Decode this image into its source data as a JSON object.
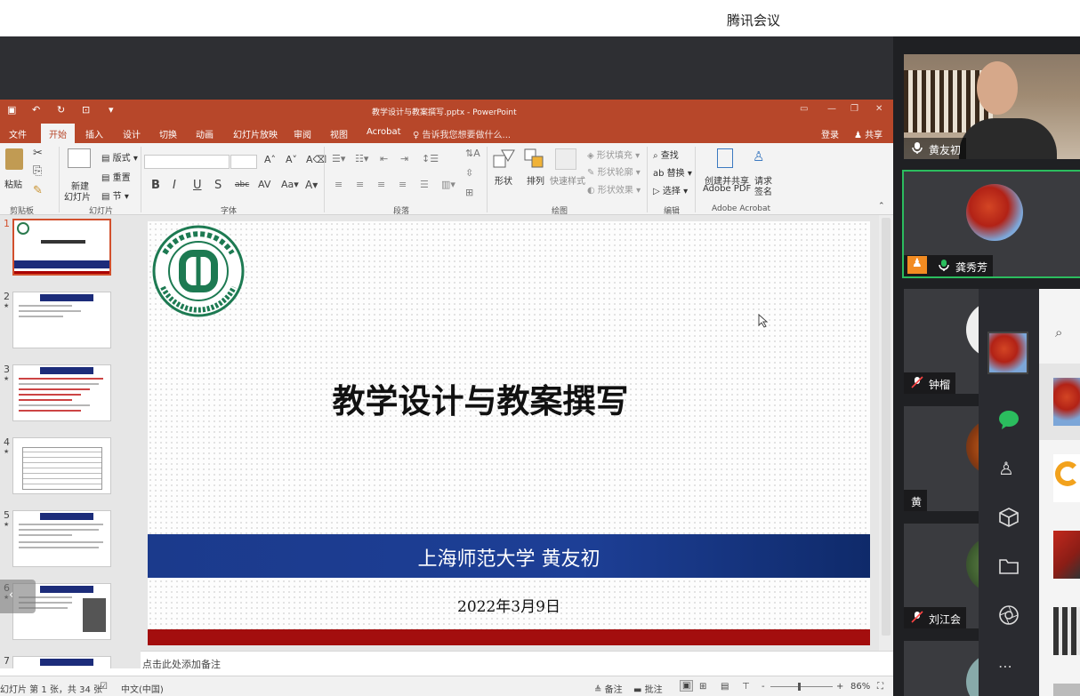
{
  "app": {
    "title": "腾讯会议"
  },
  "ppt": {
    "document_title": "教学设计与教案撰写.pptx - PowerPoint",
    "tabs": [
      "文件",
      "开始",
      "插入",
      "设计",
      "切换",
      "动画",
      "幻灯片放映",
      "审阅",
      "视图",
      "Acrobat"
    ],
    "active_tab": "开始",
    "tell_me": "告诉我您想要做什么...",
    "login": "登录",
    "share": "共享",
    "ribbon": {
      "paste": "粘贴",
      "clipboard": "剪贴板",
      "layout": "版式",
      "reset": "重置",
      "new_slide_1": "新建",
      "new_slide_2": "幻灯片",
      "section": "节",
      "slides_group": "幻灯片",
      "font_group": "字体",
      "paragraph_group": "段落",
      "shapes": "形状",
      "arrange": "排列",
      "quick_styles": "快速样式",
      "shape_fill": "形状填充",
      "shape_outline": "形状轮廓",
      "shape_effects": "形状效果",
      "drawing_group": "绘图",
      "find": "查找",
      "replace": "替换",
      "select": "选择",
      "editing_group": "编辑",
      "create_share_1": "创建并共享",
      "create_share_2": "Adobe PDF",
      "request_1": "请求",
      "request_2": "签名",
      "acrobat_group": "Adobe Acrobat"
    },
    "slide": {
      "title": "教学设计与教案撰写",
      "author": "上海师范大学 黄友初",
      "date": "2022年3月9日",
      "logo_text": "上海师范大学 SHANGHAI NORMAL UNIVERSITY"
    },
    "thumbnail_numbers": [
      "1",
      "2",
      "3",
      "4",
      "5",
      "6",
      "7"
    ],
    "notes_placeholder": "点击此处添加备注",
    "status": {
      "slide_info": "幻灯片 第 1 张，共 34 张",
      "language": "中文(中国)",
      "notes": "备注",
      "comments": "批注",
      "zoom": "86%"
    }
  },
  "participants": [
    {
      "name": "黄友初",
      "video": true
    },
    {
      "name": "龚秀芳",
      "video": false,
      "speaking": true
    },
    {
      "name": "钟榴",
      "muted": true
    },
    {
      "name": "黄",
      "muted": false
    },
    {
      "name": "刘江会",
      "muted": true
    }
  ],
  "colors": {
    "ppt_accent": "#b7472a",
    "slide_band": "#1d3f96",
    "slide_red": "#a30e0e",
    "active_speaker": "#2bbd5e"
  }
}
